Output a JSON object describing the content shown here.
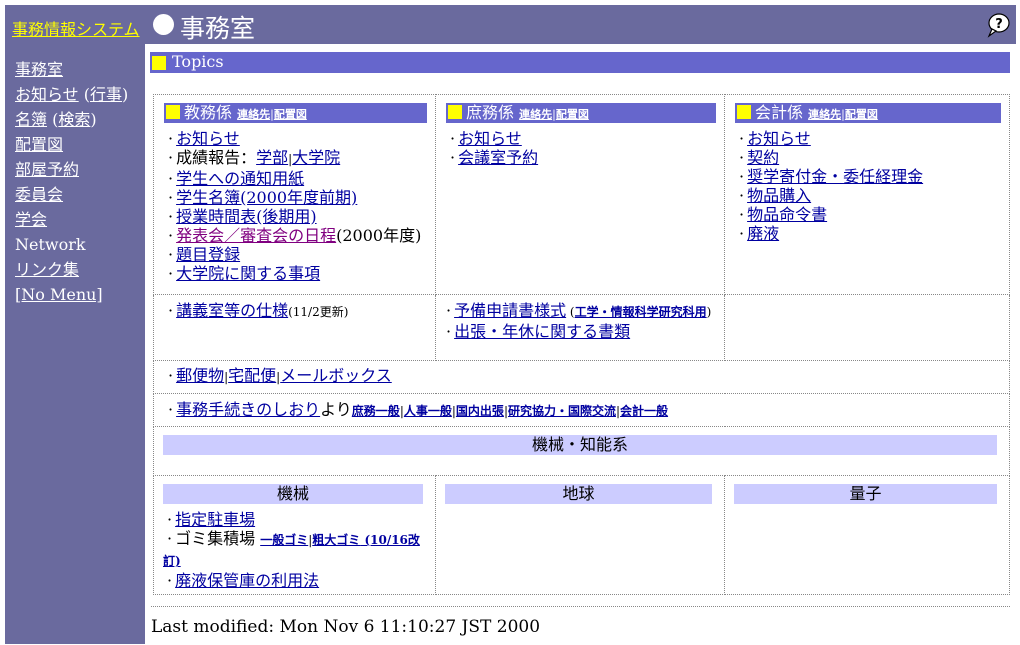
{
  "header": {
    "system_link": "事務情報システム",
    "title": "事務室",
    "help_icon": "help-balloon-icon"
  },
  "sidebar": {
    "items": [
      {
        "parts": [
          {
            "text": "事務室",
            "link": true
          }
        ]
      },
      {
        "parts": [
          {
            "text": "お知らせ",
            "link": true
          },
          {
            "text": " (",
            "link": false
          },
          {
            "text": "行事",
            "link": true
          },
          {
            "text": ")",
            "link": false
          }
        ]
      },
      {
        "parts": [
          {
            "text": "名簿",
            "link": true
          },
          {
            "text": " (",
            "link": false
          },
          {
            "text": "検索",
            "link": true
          },
          {
            "text": ")",
            "link": false
          }
        ]
      },
      {
        "parts": [
          {
            "text": "配置図",
            "link": true
          }
        ]
      },
      {
        "parts": [
          {
            "text": "部屋予約",
            "link": true
          }
        ]
      },
      {
        "parts": [
          {
            "text": "委員会",
            "link": true
          }
        ]
      },
      {
        "parts": [
          {
            "text": "学会",
            "link": true
          }
        ]
      },
      {
        "parts": [
          {
            "text": "Network",
            "link": false
          }
        ]
      },
      {
        "parts": [
          {
            "text": "リンク集",
            "link": true
          }
        ]
      },
      {
        "parts": [
          {
            "text": "[No Menu]",
            "link": true
          }
        ]
      }
    ]
  },
  "topics": {
    "label": "Topics"
  },
  "kyomu": {
    "title": "教務係",
    "contact": "連絡先",
    "sep": "|",
    "map": "配置図",
    "oshirase": "お知らせ",
    "seiseki": "成績報告：",
    "gakubu": "学部",
    "bar": "|",
    "daigakuin": "大学院",
    "tsuchi": "学生への通知用紙",
    "meibo": "学生名簿(2000年度前期)",
    "jikanwari": "授業時間表(後期用)",
    "happyokai": "発表会／審査会の日程",
    "nendo": "(2000年度)",
    "daimoku": "題目登録",
    "daigakuin_jiko": "大学院に関する事項"
  },
  "shomu": {
    "title": "庶務係",
    "contact": "連絡先",
    "sep": "|",
    "map": "配置図",
    "oshirase": "お知らせ",
    "kaigishitsu": "会議室予約"
  },
  "kaikei": {
    "title": "会計係",
    "contact": "連絡先",
    "sep": "|",
    "map": "配置図",
    "oshirase": "お知らせ",
    "keiyaku": "契約",
    "shogaku": "奨学寄付金・委任経理金",
    "buppin": "物品購入",
    "meirei": "物品命令書",
    "haieki": "廃液"
  },
  "row2": {
    "kogishitsu": "講義室等の仕様",
    "kogishitsu_note": "(11/2更新)",
    "yobi": "予備申請書様式",
    "yobi_note_open": " (",
    "yobi_note": "工学・情報科学研究科用",
    "yobi_note_close": ")",
    "shucho": "出張・年休に関する書類"
  },
  "mail": {
    "yubin": "郵便物",
    "sep": "|",
    "takuhai": "宅配便",
    "mailbox": "メールボックス"
  },
  "tetsuzuki": {
    "shiori": "事務手続きのしおり",
    "yori": "より",
    "links": [
      "庶務一般",
      "人事一般",
      "国内出張",
      "研究協力・国際交流",
      "会計一般"
    ],
    "sep": "|"
  },
  "kikai_chino": {
    "label": "機械・知能系"
  },
  "depts": {
    "kikai": "機械",
    "chikyu": "地球",
    "ryoshi": "量子",
    "chutei": "指定駐車場",
    "gomi": "ゴミ集積場 ",
    "ippan_gomi": "一般ゴミ",
    "sep": "|",
    "sodai_gomi": "粗大ゴミ",
    "sodai_note": " (10/16改訂)",
    "haieki_hokan": "廃液保管庫の利用法"
  },
  "footer": {
    "text": "Last modified: Mon Nov 6 11:10:27 JST 2000"
  },
  "colors": {
    "frame": "#6a6a9e",
    "bar": "#6666cc",
    "lavender": "#ccccff",
    "accent": "#ffff00",
    "link": "#0000a0",
    "visited": "#800080"
  }
}
